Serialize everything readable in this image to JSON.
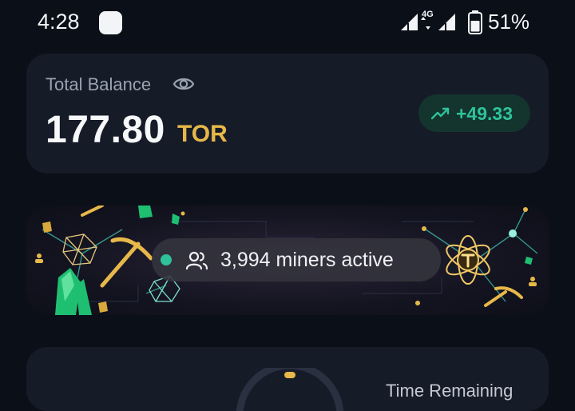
{
  "status_bar": {
    "time": "4:28",
    "network": "4G",
    "battery_percent": "51%",
    "icons": [
      "notification-icon",
      "signal-icon",
      "battery-icon"
    ]
  },
  "balance": {
    "label": "Total Balance",
    "amount": "177.80",
    "currency": "TOR",
    "change": "+49.33",
    "change_color": "#2fc29a",
    "currency_color": "#e6b84a"
  },
  "banner": {
    "miners_text": "3,994 miners active",
    "live_color": "#2fc29a"
  },
  "bottom_card": {
    "label": "Time Remaining"
  }
}
